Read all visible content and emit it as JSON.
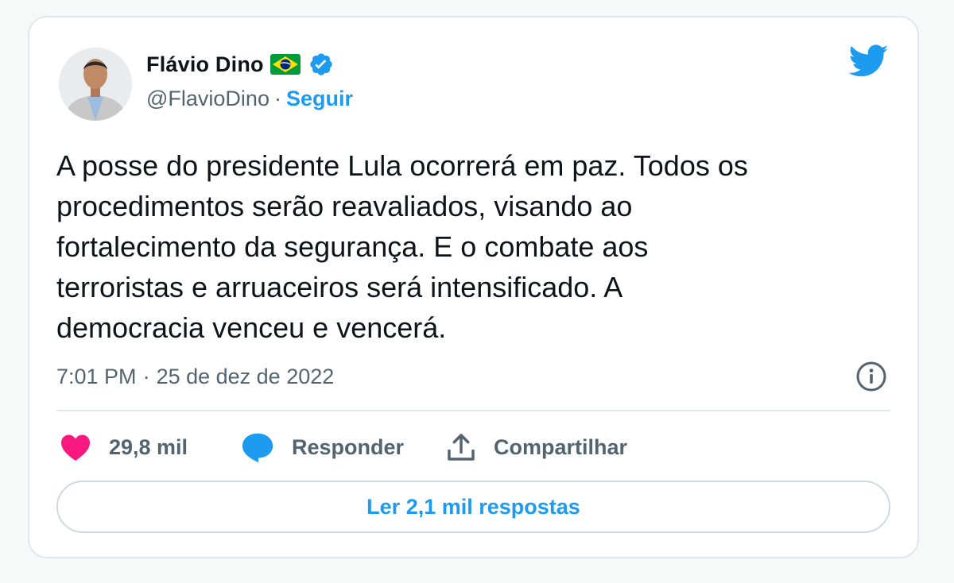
{
  "author": {
    "name": "Flávio Dino",
    "handle": "@FlavioDino",
    "separator": "·",
    "follow_label": "Seguir"
  },
  "tweet": {
    "text": "A posse do presidente Lula ocorrerá em paz. Todos os\nprocedimentos serão reavaliados, visando ao\nfortalecimento da segurança. E o combate aos\nterroristas e arruaceiros será intensificado. A\ndemocracia venceu e vencerá.",
    "time": "7:01 PM",
    "separator": "·",
    "date": "25 de dez de 2022"
  },
  "actions": {
    "likes_count": "29,8 mil",
    "reply_label": "Responder",
    "share_label": "Compartilhar"
  },
  "footer": {
    "read_replies_label": "Ler 2,1 mil respostas"
  },
  "icons": {
    "brand": "twitter-bird-icon",
    "verified": "verified-badge-icon",
    "flag": "brazil-flag-icon",
    "like": "heart-icon",
    "reply": "speech-bubble-icon",
    "share": "share-upload-icon",
    "info": "info-icon"
  },
  "colors": {
    "accent": "#1d9bf0",
    "like": "#f91880",
    "text": "#0f1419",
    "muted": "#536471",
    "border": "#e1e8ed"
  }
}
